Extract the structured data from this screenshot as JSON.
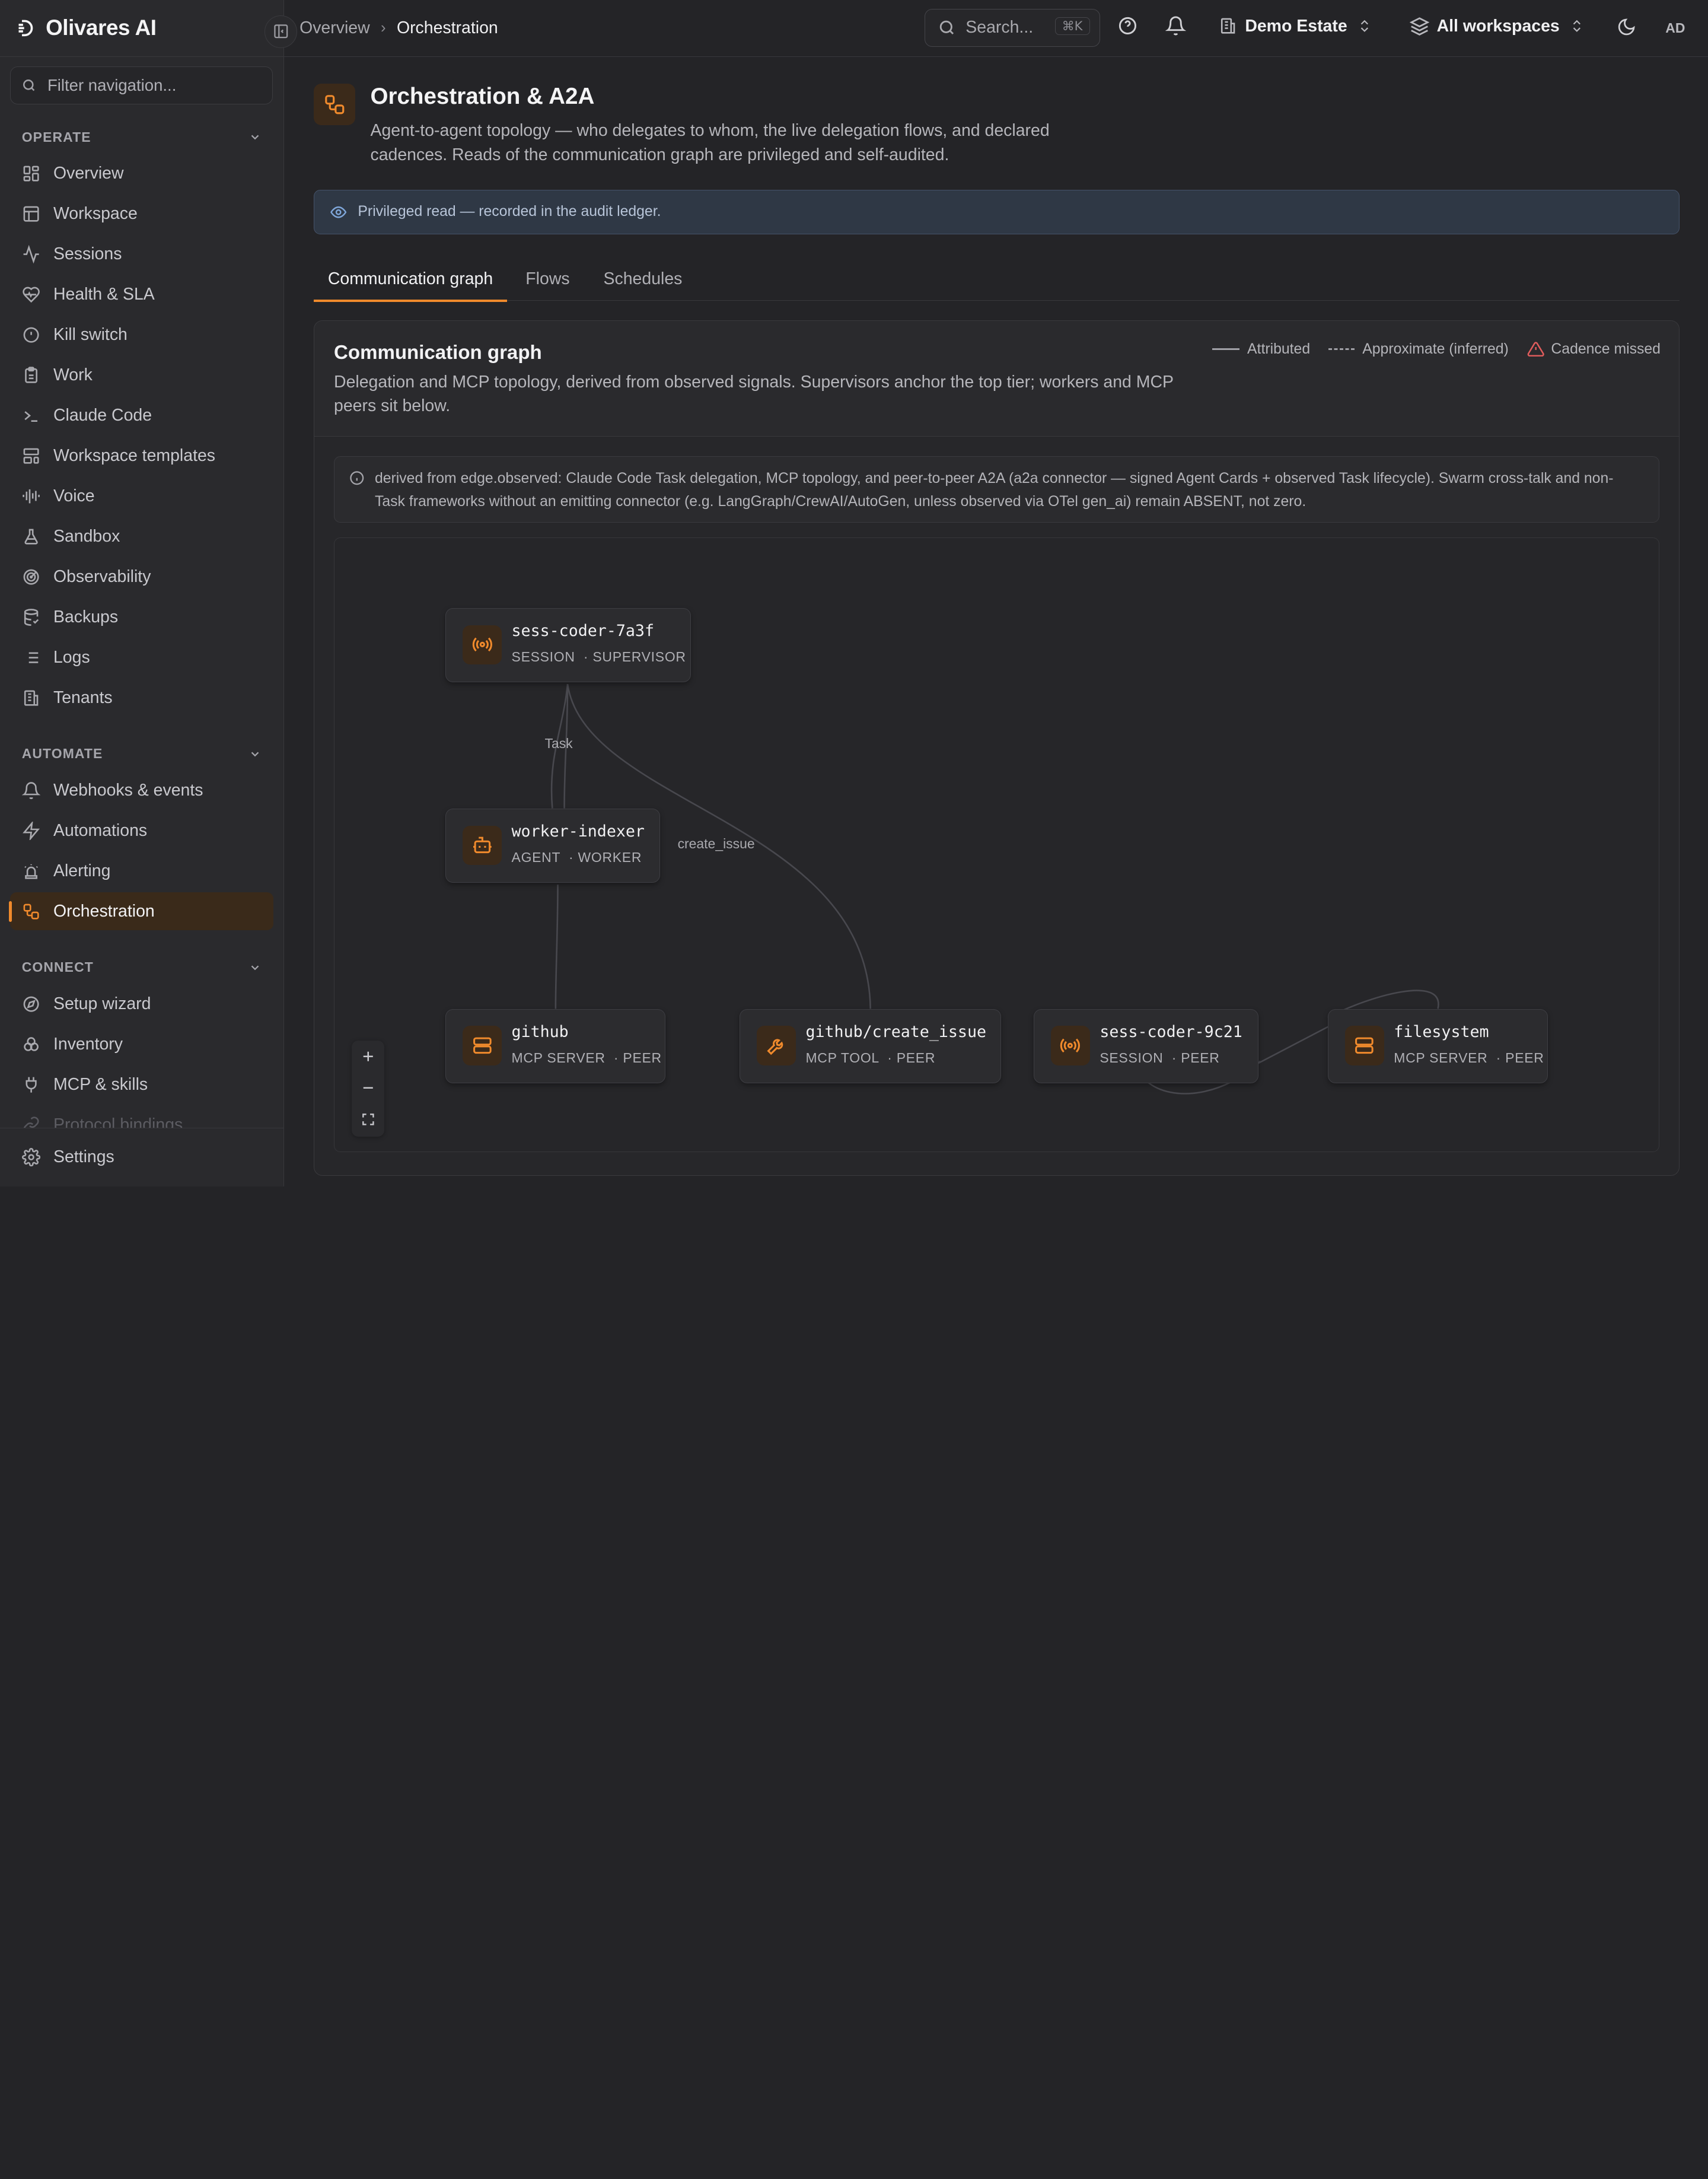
{
  "app": {
    "brand": "Olivares AI",
    "accent_color": "#f08a2c",
    "filter_placeholder": "Filter navigation..."
  },
  "sidebar": {
    "sections": [
      {
        "label": "OPERATE",
        "items": [
          {
            "label": "Overview",
            "icon": "grid-icon"
          },
          {
            "label": "Workspace",
            "icon": "layout-icon"
          },
          {
            "label": "Sessions",
            "icon": "activity-icon"
          },
          {
            "label": "Health & SLA",
            "icon": "heart-pulse-icon"
          },
          {
            "label": "Kill switch",
            "icon": "alert-circle-icon"
          },
          {
            "label": "Work",
            "icon": "clipboard-icon"
          },
          {
            "label": "Claude Code",
            "icon": "terminal-icon"
          },
          {
            "label": "Workspace templates",
            "icon": "template-icon"
          },
          {
            "label": "Voice",
            "icon": "audio-wave-icon"
          },
          {
            "label": "Sandbox",
            "icon": "flask-icon"
          },
          {
            "label": "Observability",
            "icon": "radar-icon"
          },
          {
            "label": "Backups",
            "icon": "database-backup-icon"
          },
          {
            "label": "Logs",
            "icon": "list-icon"
          },
          {
            "label": "Tenants",
            "icon": "building-icon"
          }
        ]
      },
      {
        "label": "AUTOMATE",
        "items": [
          {
            "label": "Webhooks & events",
            "icon": "bell-icon"
          },
          {
            "label": "Automations",
            "icon": "zap-icon"
          },
          {
            "label": "Alerting",
            "icon": "siren-icon"
          },
          {
            "label": "Orchestration",
            "icon": "workflow-icon",
            "active": true
          }
        ]
      },
      {
        "label": "CONNECT",
        "items": [
          {
            "label": "Setup wizard",
            "icon": "compass-icon"
          },
          {
            "label": "Inventory",
            "icon": "boxes-icon"
          },
          {
            "label": "MCP & skills",
            "icon": "plug-icon"
          },
          {
            "label": "Protocol bindings",
            "icon": "link-icon"
          }
        ]
      }
    ],
    "footer": {
      "label": "Settings",
      "icon": "gear-icon"
    }
  },
  "topbar": {
    "breadcrumb": [
      "Overview",
      "Orchestration"
    ],
    "search_placeholder": "Search...",
    "search_shortcut": "⌘K",
    "tenant": "Demo Estate",
    "workspace": "All workspaces",
    "avatar": "AD"
  },
  "page": {
    "title": "Orchestration & A2A",
    "description": "Agent-to-agent topology — who delegates to whom, the live delegation flows, and declared cadences. Reads of the communication graph are privileged and self-audited.",
    "banner": "Privileged read — recorded in the audit ledger.",
    "tabs": [
      "Communication graph",
      "Flows",
      "Schedules"
    ],
    "active_tab": 0
  },
  "graph_card": {
    "title": "Communication graph",
    "description": "Delegation and MCP topology, derived from observed signals. Supervisors anchor the top tier; workers and MCP peers sit below.",
    "legend": {
      "attributed": "Attributed",
      "approximate": "Approximate (inferred)",
      "cadence_missed": "Cadence missed"
    },
    "note": "derived from edge.observed: Claude Code Task delegation, MCP topology, and peer-to-peer A2A (a2a connector — signed Agent Cards + observed Task lifecycle). Swarm cross-talk and non-Task frameworks without an emitting connector (e.g. LangGraph/CrewAI/AutoGen, unless observed via OTel gen_ai) remain ABSENT, not zero."
  },
  "graph": {
    "nodes": [
      {
        "id": "sess-coder-7a3f",
        "kind": "SESSION",
        "role": "SUPERVISOR",
        "icon": "broadcast-icon"
      },
      {
        "id": "worker-indexer",
        "kind": "AGENT",
        "role": "WORKER",
        "icon": "bot-icon"
      },
      {
        "id": "github",
        "kind": "MCP SERVER",
        "role": "PEER",
        "icon": "server-icon"
      },
      {
        "id": "github/create_issue",
        "kind": "MCP TOOL",
        "role": "PEER",
        "icon": "wrench-icon"
      },
      {
        "id": "sess-coder-9c21",
        "kind": "SESSION",
        "role": "PEER",
        "icon": "broadcast-icon"
      },
      {
        "id": "filesystem",
        "kind": "MCP SERVER",
        "role": "PEER",
        "icon": "server-icon"
      }
    ],
    "edge_labels": {
      "task": "Task",
      "create_issue": "create_issue"
    },
    "edge_color": "#4a4a50"
  }
}
